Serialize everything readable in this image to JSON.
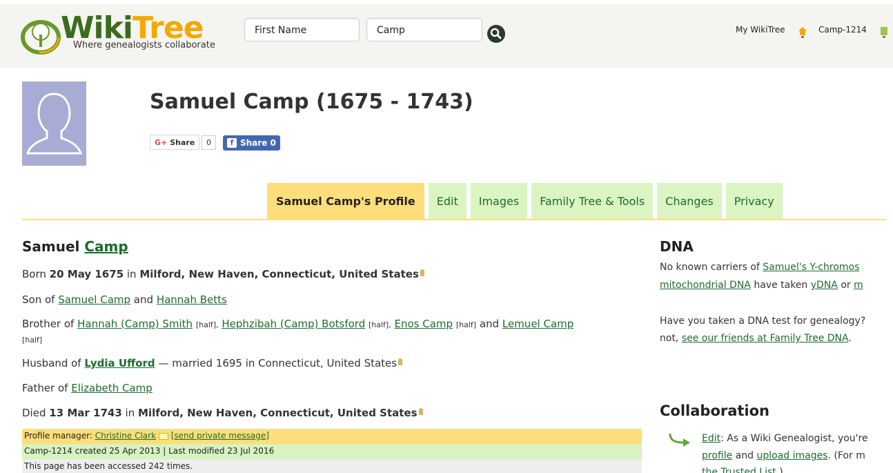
{
  "header": {
    "logo_wiki": "Wiki",
    "logo_tree": "Tree",
    "tagline": "Where genealogists collaborate",
    "first_name_value": "First Name",
    "last_name_value": "Camp",
    "my_wikitree": "My WikiTree",
    "user_id": "Camp-1214"
  },
  "profile": {
    "title": "Samuel Camp (1675 - 1743)",
    "gplus_share": "Share",
    "gplus_count": "0",
    "fb_share": "Share 0"
  },
  "tabs": [
    {
      "label": "Samuel Camp's Profile",
      "active": true
    },
    {
      "label": "Edit"
    },
    {
      "label": "Images"
    },
    {
      "label": "Family Tree & Tools"
    },
    {
      "label": "Changes"
    },
    {
      "label": "Privacy"
    }
  ],
  "bio": {
    "given": "Samuel",
    "surname": "Camp",
    "born_prefix": "Born",
    "born_date": "20 May 1675",
    "born_in": "in",
    "born_place": "Milford, New Haven, Connecticut, United States",
    "son_of": "Son of",
    "father": "Samuel Camp",
    "and": "and",
    "mother": "Hannah Betts",
    "brother_of": "Brother of",
    "sib1": "Hannah (Camp) Smith",
    "sib2": "Hephzibah (Camp) Botsford",
    "sib3": "Enos Camp",
    "sib4": "Lemuel Camp",
    "half": "[half]",
    "half_comma": "[half],",
    "husband_of": "Husband of",
    "spouse": "Lydia Ufford",
    "married": "— married 1695 in Connecticut, United States",
    "father_of": "Father of",
    "child": "Elizabeth Camp",
    "died_prefix": "Died",
    "died_date": "13 Mar 1743",
    "died_in": "in",
    "died_place": "Milford, New Haven, Connecticut, United States"
  },
  "meta": {
    "manager_label": "Profile manager:",
    "manager_name": "Christine Clark",
    "send_message": "[send private message]",
    "created": "Camp-1214 created 25 Apr 2013 | Last modified 23 Jul 2016",
    "accessed": "This page has been accessed 242 times."
  },
  "dna": {
    "heading": "DNA",
    "line1_a": "No known carriers of ",
    "line1_link": "Samuel's Y-chromos",
    "line2_link1": "mitochondrial DNA",
    "line2_mid": " have taken ",
    "line2_link2": "yDNA",
    "line2_end": " or ",
    "line2_link3": "m",
    "line3": "Have you taken a DNA test for genealogy?",
    "line4_a": "not, ",
    "line4_link": "see our friends at Family Tree DNA",
    "line4_end": "."
  },
  "collab": {
    "heading": "Collaboration",
    "edit_link": "Edit",
    "line1": ": As a Wiki Genealogist, you're",
    "profile_link": "profile",
    "and": " and ",
    "upload_link": "upload images",
    "line2_end": ". (For m",
    "line3_link": "the Trusted List",
    "line3_end": ".)"
  },
  "colors": {
    "tab_active": "#fede7a",
    "tab": "#dbf5c2",
    "link": "#1c6b2d"
  }
}
